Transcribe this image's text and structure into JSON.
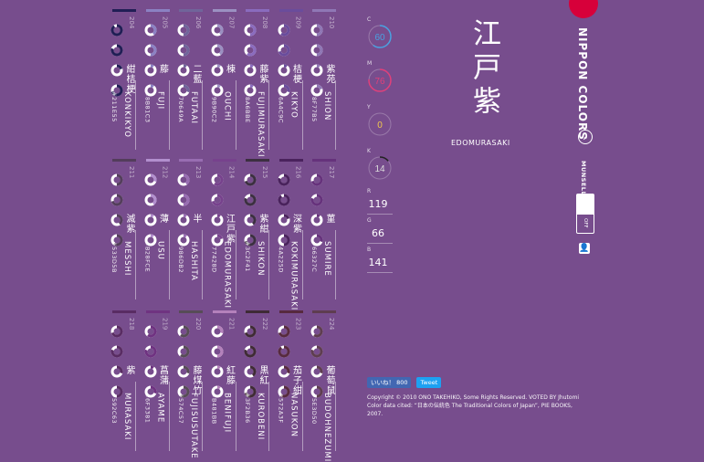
{
  "colors": {
    "bg": "#774d8d",
    "logo": "#d7003a",
    "like": "#4267b2",
    "tweet": "#1da1f2"
  },
  "grid": {
    "row1": [
      {
        "num": "204",
        "kanji": "紺桔梗",
        "hex": "#211E55",
        "romaji": "KONKIKYO",
        "bar": "#211e55",
        "donuts": [
          0.9,
          0.8,
          0.2,
          0.7
        ]
      },
      {
        "num": "205",
        "kanji": "藤",
        "hex": "#8B81C3",
        "romaji": "FUJI",
        "bar": "#8b81c3",
        "donuts": [
          0.4,
          0.5,
          0.1,
          0.1
        ]
      },
      {
        "num": "206",
        "kanji": "二藍",
        "hex": "#70649A",
        "romaji": "FUTAAI",
        "bar": "#70649a",
        "donuts": [
          0.5,
          0.5,
          0.1,
          0.3
        ]
      },
      {
        "num": "207",
        "kanji": "棟",
        "hex": "#9B90C2",
        "romaji": "OUCHI",
        "bar": "#9b90c2",
        "donuts": [
          0.4,
          0.4,
          0.1,
          0.1
        ]
      },
      {
        "num": "208",
        "kanji": "藤紫",
        "hex": "#8A6BBE",
        "romaji": "FUJIMURASAKI",
        "bar": "#8a6bbe",
        "donuts": [
          0.5,
          0.6,
          0.1,
          0.1
        ]
      },
      {
        "num": "209",
        "kanji": "桔梗",
        "hex": "#6A4C9C",
        "romaji": "KIKYO",
        "bar": "#6a4c9c",
        "donuts": [
          0.6,
          0.7,
          0.1,
          0.3
        ]
      },
      {
        "num": "210",
        "kanji": "紫苑",
        "hex": "#8F77B5",
        "romaji": "SHION",
        "bar": "#8f77b5",
        "donuts": [
          0.5,
          0.5,
          0.1,
          0.2
        ]
      }
    ],
    "row2": [
      {
        "num": "211",
        "kanji": "滅紫",
        "hex": "#533D5B",
        "romaji": "MESSHI",
        "bar": "#533d5b",
        "donuts": [
          0.5,
          0.7,
          0.4,
          0.6
        ]
      },
      {
        "num": "212",
        "kanji": "薄",
        "hex": "#B28FCE",
        "romaji": "USU",
        "bar": "#b28fce",
        "donuts": [
          0.3,
          0.4,
          0.1,
          0.1
        ]
      },
      {
        "num": "213",
        "kanji": "半",
        "hex": "#986DB2",
        "romaji": "HASHITA",
        "bar": "#986db2",
        "donuts": [
          0.4,
          0.5,
          0.1,
          0.1
        ]
      },
      {
        "num": "214",
        "kanji": "江戸紫",
        "hex": "#77428D",
        "romaji": "EDOMURASAKI",
        "bar": "#77428d",
        "donuts": [
          0.6,
          0.7,
          0.1,
          0.2
        ]
      },
      {
        "num": "215",
        "kanji": "紫紺",
        "hex": "#3C2F41",
        "romaji": "SHIKON",
        "bar": "#3c2f41",
        "donuts": [
          0.7,
          0.8,
          0.4,
          0.7
        ]
      },
      {
        "num": "216",
        "kanji": "深紫",
        "hex": "#4A225D",
        "romaji": "KOKIMURASAKI",
        "bar": "#4a225d",
        "donuts": [
          0.8,
          0.9,
          0.2,
          0.5
        ]
      },
      {
        "num": "217",
        "kanji": "菫",
        "hex": "#66327C",
        "romaji": "SUMIRE",
        "bar": "#66327c",
        "donuts": [
          0.7,
          0.8,
          0.1,
          0.3
        ]
      }
    ],
    "row3": [
      {
        "num": "218",
        "kanji": "紫",
        "hex": "#592C63",
        "romaji": "MURASAKI",
        "bar": "#592c63",
        "donuts": [
          0.7,
          0.8,
          0.3,
          0.5
        ]
      },
      {
        "num": "219",
        "kanji": "菖蒲",
        "hex": "#6F3381",
        "romaji": "AYAME",
        "bar": "#6f3381",
        "donuts": [
          0.6,
          0.8,
          0.1,
          0.3
        ]
      },
      {
        "num": "220",
        "kanji": "藤煤竹",
        "hex": "#574C57",
        "romaji": "FUJISUSUTAKE",
        "bar": "#574c57",
        "donuts": [
          0.6,
          0.6,
          0.3,
          0.6
        ]
      },
      {
        "num": "221",
        "kanji": "紅藤",
        "hex": "#B481BB",
        "romaji": "BENIFUJI",
        "bar": "#b481bb",
        "donuts": [
          0.3,
          0.5,
          0.1,
          0.1
        ]
      },
      {
        "num": "222",
        "kanji": "黒紅",
        "hex": "#3F2B36",
        "romaji": "KUROBENI",
        "bar": "#3f2b36",
        "donuts": [
          0.7,
          0.8,
          0.4,
          0.7
        ]
      },
      {
        "num": "223",
        "kanji": "茄子紺",
        "hex": "#572A3F",
        "romaji": "NASUKON",
        "bar": "#572a3f",
        "donuts": [
          0.7,
          0.9,
          0.3,
          0.6
        ]
      },
      {
        "num": "224",
        "kanji": "葡萄鼠",
        "hex": "#5E3D50",
        "romaji": "BUDOHNEZUMI",
        "bar": "#5e3d50",
        "donuts": [
          0.6,
          0.8,
          0.3,
          0.5
        ]
      }
    ]
  },
  "detail": {
    "kanji": "江戸紫",
    "romaji": "EDOMURASAKI",
    "cmyk": [
      {
        "label": "C",
        "value": "60",
        "ring": "#4aa0e0",
        "fill": 0.6
      },
      {
        "label": "M",
        "value": "76",
        "ring": "#e0407a",
        "fill": 0.76
      },
      {
        "label": "Y",
        "value": "0",
        "ring": "#f2c94c",
        "fill": 0.0
      },
      {
        "label": "K",
        "value": "14",
        "ring": "#222222",
        "fill": 0.14
      }
    ],
    "rgb": [
      {
        "label": "R",
        "value": "119"
      },
      {
        "label": "G",
        "value": "66"
      },
      {
        "label": "B",
        "value": "141"
      }
    ]
  },
  "rail": {
    "title": "NIPPON COLORS",
    "munsell": "MUNSELL",
    "switch_off": "OFF",
    "user_icon": "user-icon",
    "compass_icon": "compass-icon"
  },
  "footer": {
    "like": "いいね！ 800",
    "tweet": "Tweet",
    "copyright": "Copyright © 2010 ONO TAKEHIKO, Some Rights Reserved. VOTED BY Jhutomi",
    "cited": "Color data cited: “日本の伝統色 The Traditional Colors of Japan”, PIE BOOKS, 2007."
  }
}
